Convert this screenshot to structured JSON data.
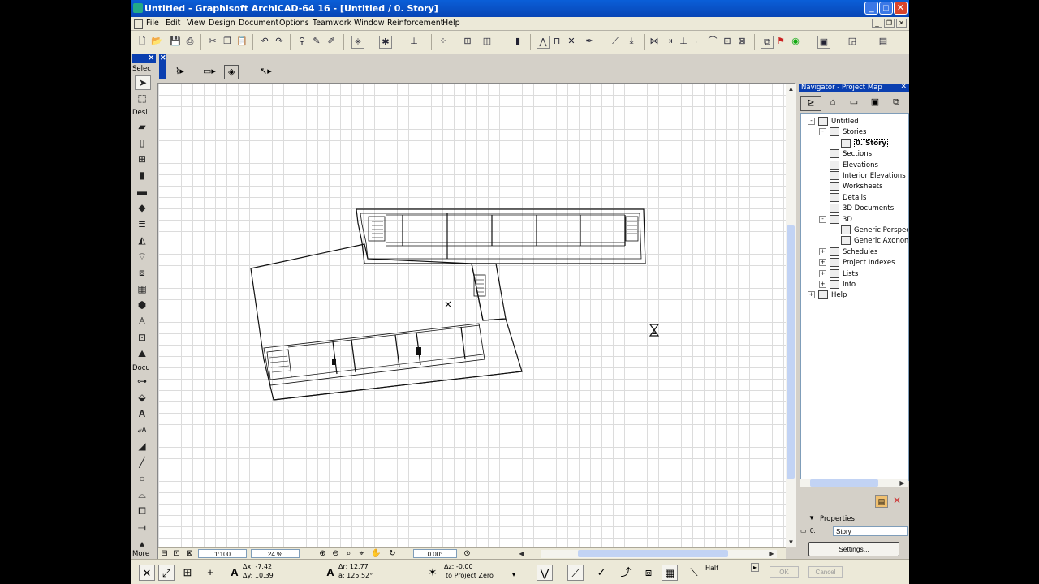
{
  "window": {
    "title": "Untitled - Graphisoft ArchiCAD-64 16 - [Untitled / 0. Story]",
    "controls": {
      "minimize": "_",
      "maximize": "□",
      "close": "✕"
    }
  },
  "menu": {
    "items": [
      "File",
      "Edit",
      "View",
      "Design",
      "Document",
      "Options",
      "Teamwork",
      "Window",
      "Reinforcement",
      "Help"
    ]
  },
  "toolbox": {
    "sections": {
      "select": "Selec",
      "design": "Desi",
      "document": "Docu",
      "more": "More"
    }
  },
  "navigator": {
    "title": "Navigator - Project Map",
    "tree": [
      {
        "label": "Untitled",
        "level": 0,
        "expander": "-"
      },
      {
        "label": "Stories",
        "level": 1,
        "expander": "-"
      },
      {
        "label": "0. Story",
        "level": 2,
        "selected": true
      },
      {
        "label": "Sections",
        "level": 1
      },
      {
        "label": "Elevations",
        "level": 1
      },
      {
        "label": "Interior Elevations",
        "level": 1
      },
      {
        "label": "Worksheets",
        "level": 1
      },
      {
        "label": "Details",
        "level": 1
      },
      {
        "label": "3D Documents",
        "level": 1
      },
      {
        "label": "3D",
        "level": 1,
        "expander": "-"
      },
      {
        "label": "Generic Perspec",
        "level": 2
      },
      {
        "label": "Generic Axonom",
        "level": 2
      },
      {
        "label": "Schedules",
        "level": 1,
        "expander": "+"
      },
      {
        "label": "Project Indexes",
        "level": 1,
        "expander": "+"
      },
      {
        "label": "Lists",
        "level": 1,
        "expander": "+"
      },
      {
        "label": "Info",
        "level": 1,
        "expander": "+"
      },
      {
        "label": "Help",
        "level": 0,
        "expander": "+"
      }
    ],
    "properties": {
      "label": "Properties",
      "id_label": "0.",
      "value": "Story",
      "settings_button": "Settings..."
    }
  },
  "view_bar": {
    "scale": "1:100",
    "zoom": "24 %",
    "angle": "0.00°"
  },
  "coordinate_box": {
    "dx": "Δx: -7.42",
    "dy": "Δy: 10.39",
    "dr": "Δr: 12.77",
    "da": "a: 125.52°",
    "dz": "Δz: -0.00",
    "to": "to Project Zero",
    "half": "Half",
    "ok": "OK",
    "cancel": "Cancel"
  },
  "canvas": {
    "origin_marker": "×",
    "cursor": "hourglass-icon"
  }
}
